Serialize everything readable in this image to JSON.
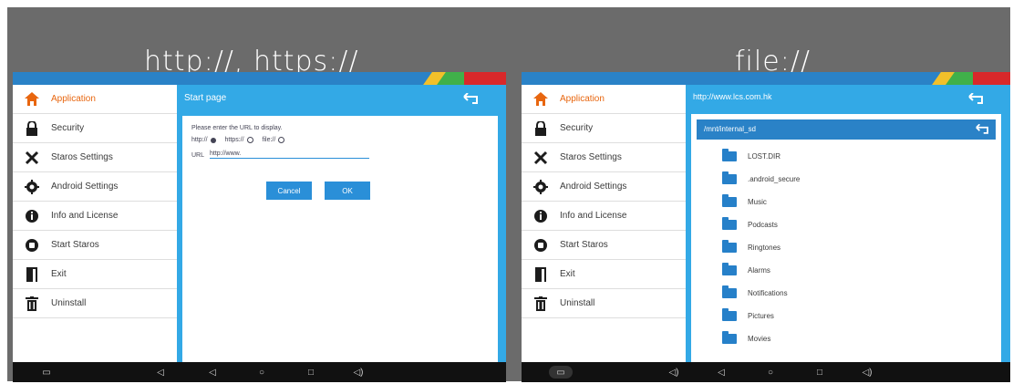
{
  "captions": {
    "left": "http://, https://",
    "right": "file://"
  },
  "sidebar": {
    "items": [
      {
        "label": "Application",
        "icon": "home-icon",
        "active": true
      },
      {
        "label": "Security",
        "icon": "lock-icon"
      },
      {
        "label": "Staros Settings",
        "icon": "tools-icon"
      },
      {
        "label": "Android Settings",
        "icon": "gear-icon"
      },
      {
        "label": "Info and License",
        "icon": "info-icon"
      },
      {
        "label": "Start Staros",
        "icon": "start-icon"
      },
      {
        "label": "Exit",
        "icon": "exit-door-icon"
      },
      {
        "label": "Uninstall",
        "icon": "trash-icon"
      }
    ]
  },
  "left_panel": {
    "title": "Start page",
    "dialog": {
      "prompt": "Please enter the URL to display.",
      "options": [
        {
          "label": "http://",
          "checked": true
        },
        {
          "label": "https://",
          "checked": false
        },
        {
          "label": "file://",
          "checked": false
        }
      ],
      "url_label": "URL",
      "url_value": "http://www.",
      "cancel_label": "Cancel",
      "ok_label": "OK"
    }
  },
  "right_panel": {
    "url": "http://www.lcs.com.hk",
    "path": "/mnt/internal_sd",
    "folders": [
      "LOST.DIR",
      ".android_secure",
      "Music",
      "Podcasts",
      "Ringtones",
      "Alarms",
      "Notifications",
      "Pictures",
      "Movies"
    ]
  },
  "colors": {
    "accent": "#e8660f",
    "header_blue": "#33a9e6",
    "top_strip": "#2a82c7",
    "navbar": "#111111"
  }
}
